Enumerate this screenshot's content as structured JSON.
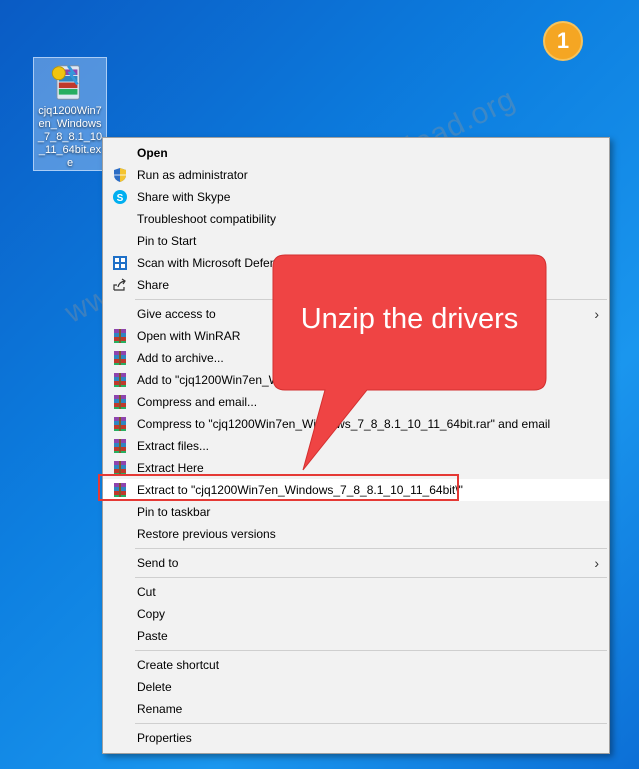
{
  "step_badge": "1",
  "desktop_icon": {
    "label": "cjq1200Win7en_Windows_7_8_8.1_10_11_64bit.exe",
    "icon": "winrar-sfx-archive-icon"
  },
  "context_menu": {
    "items": [
      {
        "label": "Open",
        "bold": true,
        "icon": ""
      },
      {
        "label": "Run as administrator",
        "icon": "uac-shield-icon"
      },
      {
        "label": "Share with Skype",
        "icon": "skype-icon"
      },
      {
        "label": "Troubleshoot compatibility",
        "icon": ""
      },
      {
        "label": "Pin to Start",
        "icon": ""
      },
      {
        "label": "Scan with Microsoft Defender...",
        "icon": "defender-icon"
      },
      {
        "label": "Share",
        "icon": "share-icon"
      },
      {
        "separator": true
      },
      {
        "label": "Give access to",
        "icon": "",
        "submenu": true
      },
      {
        "label": "Open with WinRAR",
        "icon": "winrar-icon"
      },
      {
        "label": "Add to archive...",
        "icon": "winrar-icon"
      },
      {
        "label": "Add to \"cjq1200Win7en_Windows_7_8_8.1_10_11_64bit.rar\"",
        "icon": "winrar-icon"
      },
      {
        "label": "Compress and email...",
        "icon": "winrar-icon"
      },
      {
        "label": "Compress to \"cjq1200Win7en_Windows_7_8_8.1_10_11_64bit.rar\" and email",
        "icon": "winrar-icon"
      },
      {
        "label": "Extract files...",
        "icon": "winrar-icon"
      },
      {
        "label": "Extract Here",
        "icon": "winrar-icon"
      },
      {
        "label": "Extract to \"cjq1200Win7en_Windows_7_8_8.1_10_11_64bit\\\"",
        "icon": "winrar-icon",
        "highlighted": true
      },
      {
        "label": "Pin to taskbar",
        "icon": ""
      },
      {
        "label": "Restore previous versions",
        "icon": ""
      },
      {
        "separator": true
      },
      {
        "label": "Send to",
        "icon": "",
        "submenu": true
      },
      {
        "separator": true
      },
      {
        "label": "Cut",
        "icon": ""
      },
      {
        "label": "Copy",
        "icon": ""
      },
      {
        "label": "Paste",
        "icon": ""
      },
      {
        "separator": true
      },
      {
        "label": "Create shortcut",
        "icon": ""
      },
      {
        "label": "Delete",
        "icon": ""
      },
      {
        "label": "Rename",
        "icon": ""
      },
      {
        "separator": true
      },
      {
        "label": "Properties",
        "icon": ""
      }
    ]
  },
  "callout": {
    "text": "Unzip the drivers",
    "color": "#ef4444"
  },
  "watermark": "www.freeprinterdriverdownload.org",
  "colors": {
    "highlight_border": "#e53935",
    "badge": "#f5a623"
  }
}
